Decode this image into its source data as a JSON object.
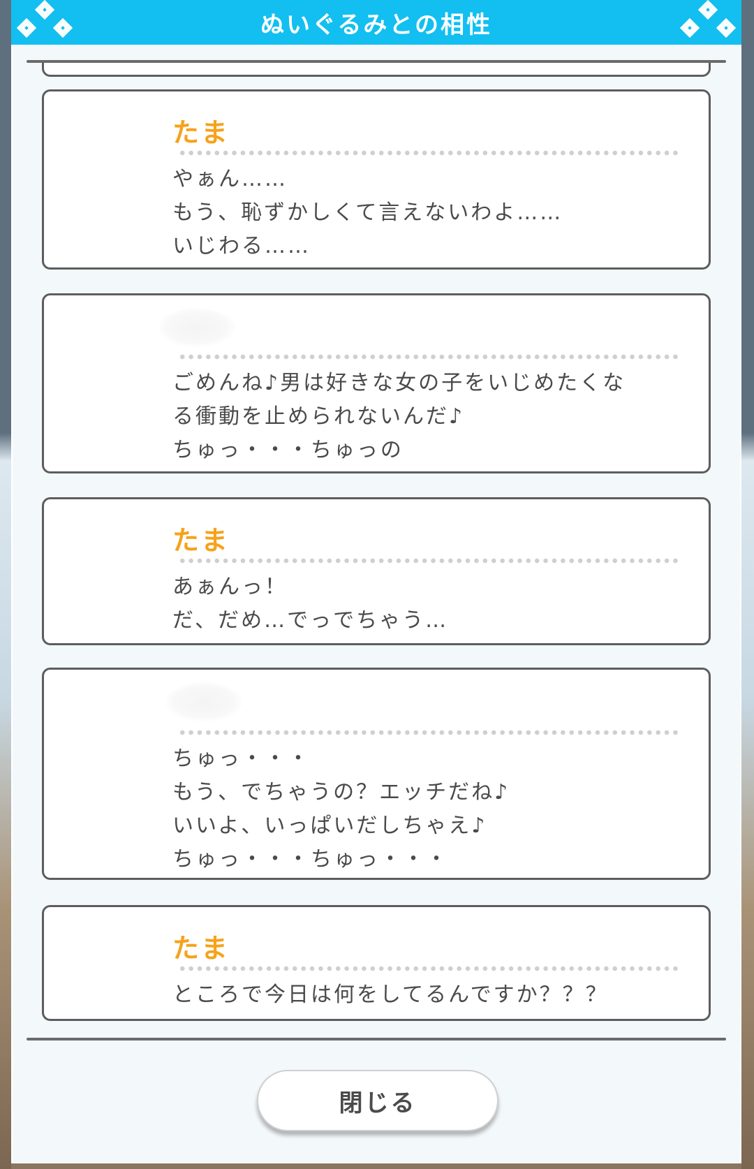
{
  "dialog": {
    "title": "ぬいぐるみとの相性",
    "close_label": "閉じる",
    "accent_color": "#12bff0",
    "speaker_color": "#f6a21a",
    "icons": [
      "diamond-ornament-icon"
    ]
  },
  "messages": [
    {
      "speaker": "たま",
      "speaker_hidden": false,
      "lines": [
        "やぁん……",
        "もう、恥ずかしくて言えないわよ……",
        "いじわる……"
      ]
    },
    {
      "speaker": "",
      "speaker_hidden": true,
      "lines": [
        "ごめんね♪男は好きな女の子をいじめたくな",
        "る衝動を止められないんだ♪",
        "ちゅっ・・・ちゅっの"
      ]
    },
    {
      "speaker": "たま",
      "speaker_hidden": false,
      "lines": [
        "あぁんっ！",
        "だ、だめ…でっでちゃう…"
      ]
    },
    {
      "speaker": "",
      "speaker_hidden": true,
      "lines": [
        "ちゅっ・・・",
        "もう、でちゃうの？エッチだね♪",
        "いいよ、いっぱいだしちゃえ♪",
        "ちゅっ・・・ちゅっ・・・"
      ]
    },
    {
      "speaker": "たま",
      "speaker_hidden": false,
      "lines": [
        "ところで今日は何をしてるんですか？？？"
      ]
    }
  ]
}
